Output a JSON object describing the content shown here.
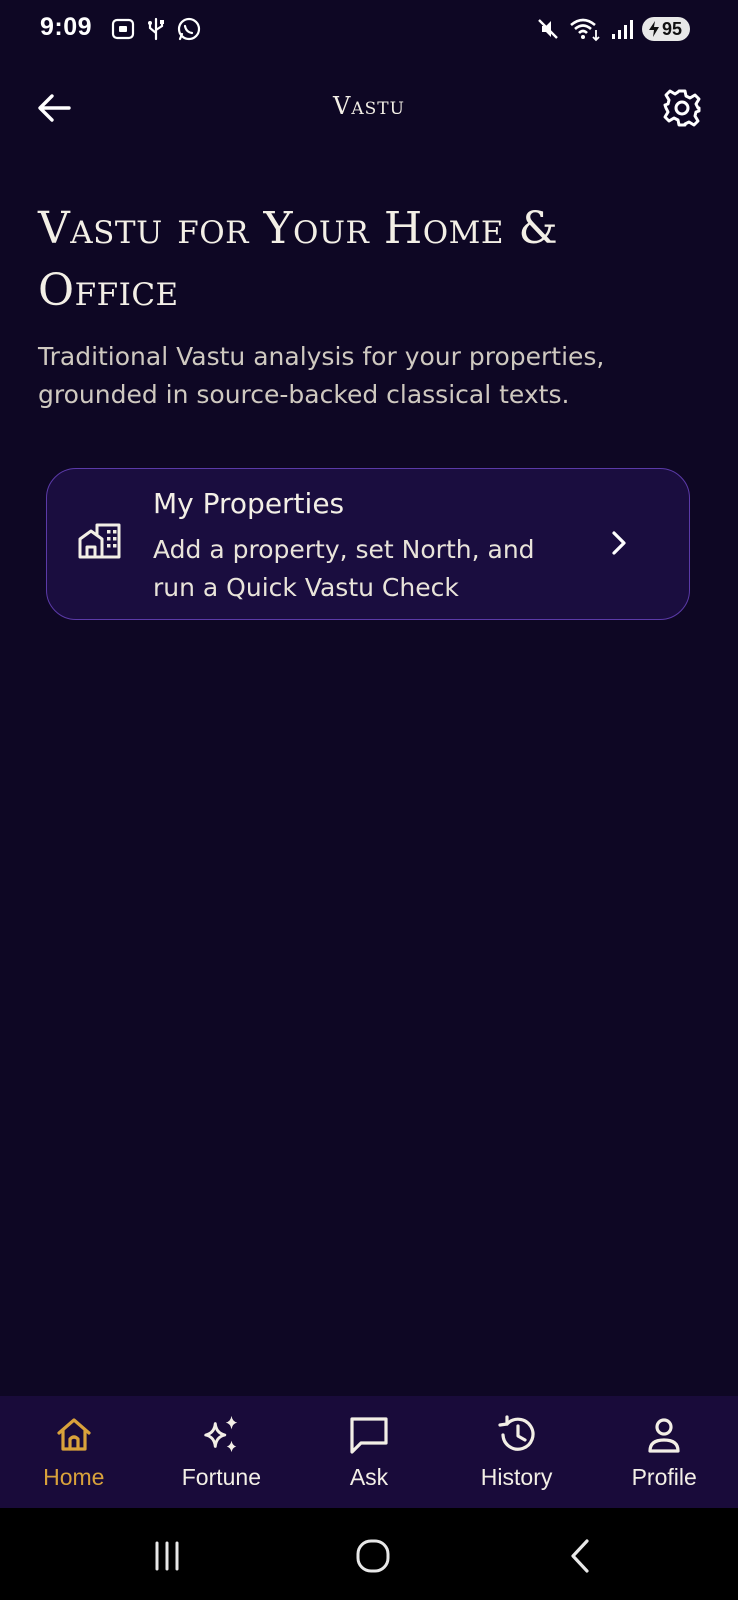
{
  "status_bar": {
    "time": "9:09",
    "battery": "95"
  },
  "app_bar": {
    "title": "Vastu"
  },
  "hero": {
    "title": "Vastu for Your Home & Office",
    "subtitle": "Traditional Vastu analysis for your properties, grounded in source-backed classical texts."
  },
  "property_card": {
    "title": "My Properties",
    "description": "Add a property, set North, and run a Quick Vastu Check"
  },
  "bottom_nav": {
    "items": [
      {
        "label": "Home",
        "icon": "home-icon",
        "active": true
      },
      {
        "label": "Fortune",
        "icon": "sparkles-icon",
        "active": false
      },
      {
        "label": "Ask",
        "icon": "chat-bubble-icon",
        "active": false
      },
      {
        "label": "History",
        "icon": "history-icon",
        "active": false
      },
      {
        "label": "Profile",
        "icon": "user-icon",
        "active": false
      }
    ]
  },
  "colors": {
    "background": "#0e0724",
    "accent_gold": "#d9a23b",
    "card_bg": "#1a0d3f",
    "card_border": "#5b3aa8",
    "nav_bg": "#190b3a"
  }
}
